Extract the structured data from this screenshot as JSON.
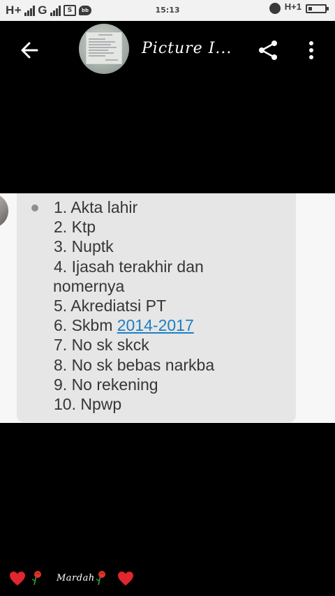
{
  "status_bar": {
    "network_1": "H+",
    "network_2": "G",
    "time": "15:13",
    "right_network": "H+1",
    "colors": {
      "background": "#f2f2f2",
      "icon": "#3a3a3a"
    }
  },
  "app_bar": {
    "title": "Picture I...",
    "back_icon": "arrow-left-icon",
    "share_icon": "share-icon",
    "more_icon": "more-vert-icon"
  },
  "message": {
    "items": [
      {
        "text": "1. Akta lahir"
      },
      {
        "text": "2. Ktp"
      },
      {
        "text": "3. Nuptk"
      },
      {
        "text": "4. Ijasah terakhir dan"
      },
      {
        "text": "nomernya"
      },
      {
        "text": "5. Akrediatsi PT"
      },
      {
        "text": "6. Skbm ",
        "link": "2014-2017"
      },
      {
        "text": "7. No sk skck"
      },
      {
        "text": "8. No sk bebas narkba"
      },
      {
        "text": "9. No rekening"
      },
      {
        "text": "10. Npwp"
      }
    ],
    "colors": {
      "bubble": "#e6e6e6",
      "text": "#363636",
      "link": "#1e7fc2"
    }
  },
  "signature": {
    "text": "Mardah",
    "icons": [
      "heart-icon",
      "rose-icon",
      "rose-icon",
      "heart-icon"
    ]
  }
}
